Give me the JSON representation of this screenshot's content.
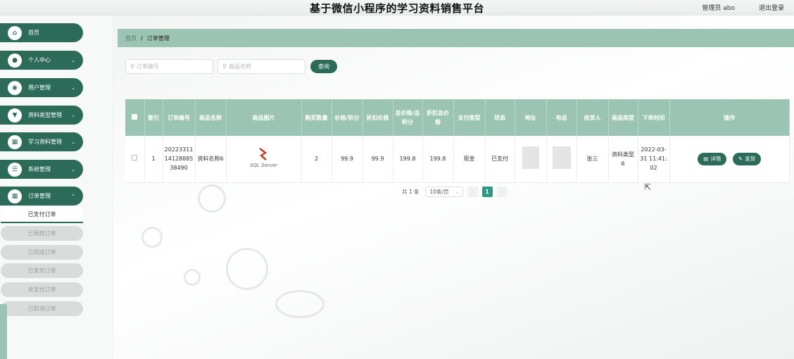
{
  "header": {
    "title": "基于微信小程序的学习资料销售平台",
    "admin": "管理员 abo",
    "logout": "退出登录"
  },
  "sidebar": {
    "items": [
      {
        "label": "首页",
        "icon": "home-icon",
        "chevron": ""
      },
      {
        "label": "个人中心",
        "icon": "user-icon",
        "chevron": "⌄"
      },
      {
        "label": "用户管理",
        "icon": "users-icon",
        "chevron": "⌄"
      },
      {
        "label": "资料类型管理",
        "icon": "category-icon",
        "chevron": "⌄"
      },
      {
        "label": "学习资料管理",
        "icon": "grid-icon",
        "chevron": "⌄"
      },
      {
        "label": "系统管理",
        "icon": "settings-icon",
        "chevron": "⌄"
      },
      {
        "label": "订单管理",
        "icon": "order-icon",
        "chevron": "⌃"
      }
    ],
    "subitems": [
      "已支付订单",
      "已退款订单",
      "已完成订单",
      "已发货订单",
      "未支付订单",
      "已取消订单"
    ]
  },
  "breadcrumb": {
    "home": "首页",
    "sep": "/",
    "current": "订单管理"
  },
  "search": {
    "order_placeholder": "订单编号",
    "product_placeholder": "商品名称",
    "button": "查询"
  },
  "table": {
    "headers": [
      "索引",
      "订单编号",
      "商品名称",
      "商品图片",
      "购买数量",
      "价格/积分",
      "折扣价格",
      "总价格/总积分",
      "折扣总价格",
      "支付类型",
      "状态",
      "地址",
      "电话",
      "收货人",
      "商品类型",
      "下单时间",
      "操作"
    ],
    "rows": [
      {
        "index": "1",
        "order_no": "202233111412888538490",
        "name": "资料名称6",
        "image_text": "SQL Server",
        "qty": "2",
        "price": "99.9",
        "discount_price": "99.9",
        "total": "199.8",
        "discount_total": "199.8",
        "pay_type": "现金",
        "status": "已支付",
        "receiver": "张三",
        "type": "资料类型6",
        "time": "2022-03-31 11:41:02"
      }
    ],
    "actions": {
      "detail": "详情",
      "ship": "发货"
    }
  },
  "pagination": {
    "total": "共 1 条",
    "page_size": "10条/页",
    "page": "1"
  },
  "colors": {
    "primary": "#2c6b57",
    "header_bg": "#9cc4b4",
    "page_active": "#2c9b83"
  }
}
